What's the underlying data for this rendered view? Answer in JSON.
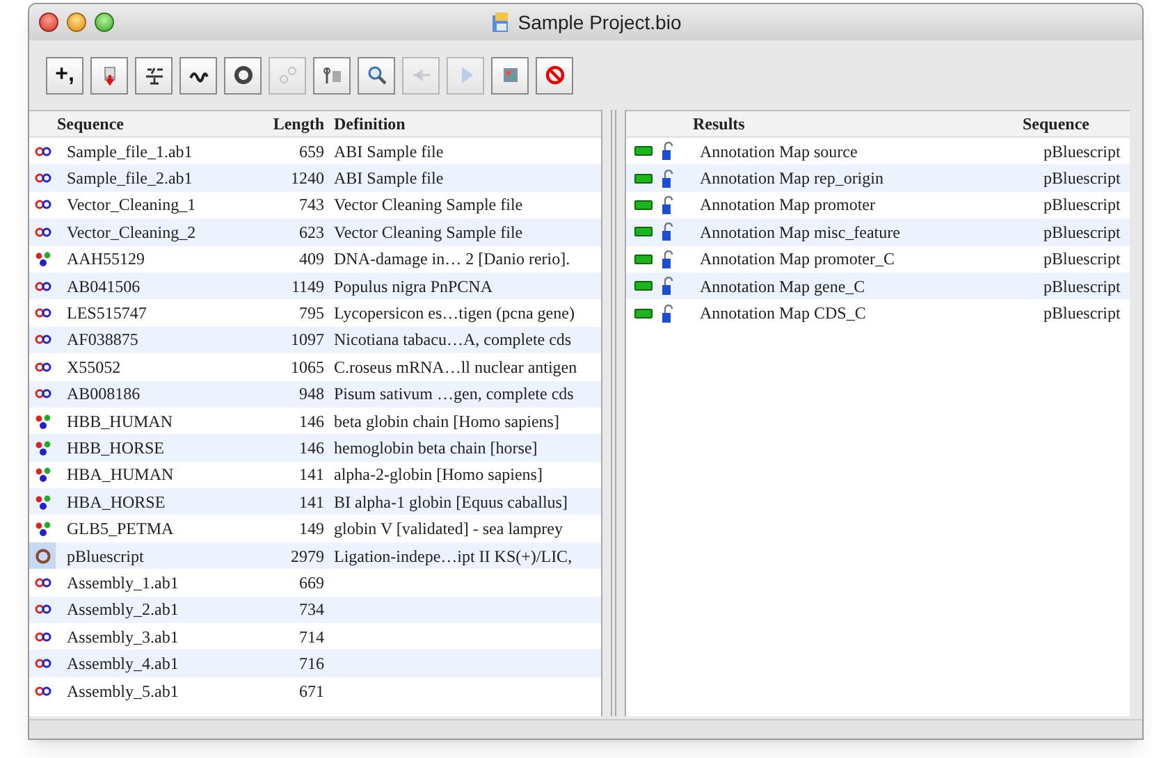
{
  "window": {
    "title": "Sample Project.bio"
  },
  "toolbar": [
    {
      "kind": "add",
      "label": "+,",
      "disabled": false
    },
    {
      "kind": "import",
      "disabled": false
    },
    {
      "kind": "align",
      "disabled": false
    },
    {
      "kind": "trace",
      "disabled": false
    },
    {
      "kind": "ring",
      "disabled": false
    },
    {
      "kind": "link",
      "disabled": true
    },
    {
      "kind": "orf",
      "disabled": false
    },
    {
      "kind": "search",
      "disabled": false
    },
    {
      "kind": "shift",
      "disabled": true
    },
    {
      "kind": "play",
      "disabled": true
    },
    {
      "kind": "grid",
      "disabled": false
    },
    {
      "kind": "stop",
      "disabled": false
    }
  ],
  "sequences": {
    "columns": [
      "Sequence",
      "Length",
      "Definition"
    ],
    "rows": [
      {
        "kind": "dna",
        "name": "Sample_file_1.ab1",
        "length": "659",
        "definition": "ABI Sample file",
        "selected": false
      },
      {
        "kind": "dna",
        "name": "Sample_file_2.ab1",
        "length": "1240",
        "definition": "ABI Sample file",
        "selected": false
      },
      {
        "kind": "dna",
        "name": "Vector_Cleaning_1",
        "length": "743",
        "definition": "Vector Cleaning Sample file",
        "selected": false
      },
      {
        "kind": "dna",
        "name": "Vector_Cleaning_2",
        "length": "623",
        "definition": "Vector Cleaning Sample file",
        "selected": false
      },
      {
        "kind": "protein",
        "name": "AAH55129",
        "length": "409",
        "definition": "DNA-damage in… 2 [Danio rerio].",
        "selected": false
      },
      {
        "kind": "dna",
        "name": "AB041506",
        "length": "1149",
        "definition": "Populus nigra PnPCNA",
        "selected": false
      },
      {
        "kind": "dna",
        "name": "LES515747",
        "length": "795",
        "definition": "Lycopersicon es…tigen (pcna gene)",
        "selected": false
      },
      {
        "kind": "dna",
        "name": "AF038875",
        "length": "1097",
        "definition": "Nicotiana tabacu…A, complete cds",
        "selected": false
      },
      {
        "kind": "dna",
        "name": "X55052",
        "length": "1065",
        "definition": "C.roseus mRNA…ll nuclear antigen",
        "selected": false
      },
      {
        "kind": "dna",
        "name": "AB008186",
        "length": "948",
        "definition": "Pisum sativum …gen, complete cds",
        "selected": false
      },
      {
        "kind": "protein",
        "name": "HBB_HUMAN",
        "length": "146",
        "definition": "beta globin chain [Homo sapiens]",
        "selected": false
      },
      {
        "kind": "protein",
        "name": "HBB_HORSE",
        "length": "146",
        "definition": "hemoglobin beta chain [horse]",
        "selected": false
      },
      {
        "kind": "protein",
        "name": "HBA_HUMAN",
        "length": "141",
        "definition": "alpha-2-globin [Homo sapiens]",
        "selected": false
      },
      {
        "kind": "protein",
        "name": "HBA_HORSE",
        "length": "141",
        "definition": "BI alpha-1 globin [Equus caballus]",
        "selected": false
      },
      {
        "kind": "protein",
        "name": "GLB5_PETMA",
        "length": "149",
        "definition": "globin V [validated] - sea lamprey",
        "selected": false
      },
      {
        "kind": "plasmid",
        "name": "pBluescript",
        "length": "2979",
        "definition": "Ligation-indepe…ipt II KS(+)/LIC,",
        "selected": true
      },
      {
        "kind": "dna",
        "name": "Assembly_1.ab1",
        "length": "669",
        "selected": false
      },
      {
        "kind": "dna",
        "name": "Assembly_2.ab1",
        "length": "734",
        "selected": false
      },
      {
        "kind": "dna",
        "name": "Assembly_3.ab1",
        "length": "714",
        "selected": false
      },
      {
        "kind": "dna",
        "name": "Assembly_4.ab1",
        "length": "716",
        "selected": false
      },
      {
        "kind": "dna",
        "name": "Assembly_5.ab1",
        "length": "671",
        "selected": false
      }
    ]
  },
  "results": {
    "columns": [
      "Results",
      "Sequence"
    ],
    "rows": [
      {
        "name": "Annotation Map source",
        "sequence": "pBluescript"
      },
      {
        "name": "Annotation Map rep_origin",
        "sequence": "pBluescript"
      },
      {
        "name": "Annotation Map promoter",
        "sequence": "pBluescript"
      },
      {
        "name": "Annotation Map misc_feature",
        "sequence": "pBluescript"
      },
      {
        "name": "Annotation Map promoter_C",
        "sequence": "pBluescript"
      },
      {
        "name": "Annotation Map gene_C",
        "sequence": "pBluescript"
      },
      {
        "name": "Annotation Map CDS_C",
        "sequence": "pBluescript"
      }
    ]
  }
}
